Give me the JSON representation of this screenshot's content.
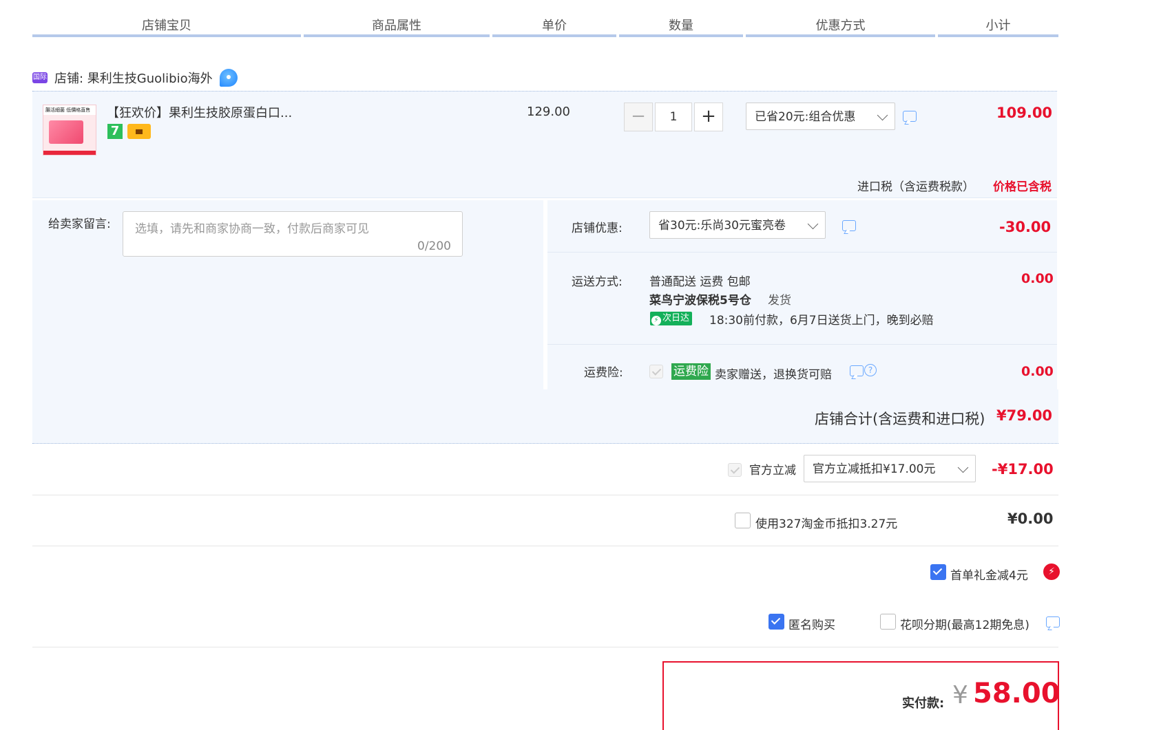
{
  "header": {
    "columns": [
      "店铺宝贝",
      "商品属性",
      "单价",
      "数量",
      "优惠方式",
      "小计"
    ]
  },
  "shop": {
    "badge": "国际",
    "name": "店铺: 果利生技Guolibio海外"
  },
  "item": {
    "thumb_text": "腸活細菌 低價格直售",
    "title": "【狂欢价】果利生技胶原蛋白口...",
    "badge_7": "7",
    "unit_price": "129.00",
    "quantity": "1",
    "discount_option": "已省20元:组合优惠",
    "subtotal": "109.00",
    "tax_label": "进口税（含运费税款）",
    "tax_value": "价格已含税"
  },
  "message": {
    "label": "给卖家留言:",
    "placeholder": "选填，请先和商家协商一致，付款后商家可见",
    "counter": "0/200"
  },
  "shop_coupon": {
    "label": "店铺优惠:",
    "option": "省30元:乐尚30元蜜亮卷",
    "amount": "-30.00"
  },
  "shipping": {
    "label": "运送方式:",
    "line1": "普通配送 运费 包邮",
    "warehouse": "菜鸟宁波保税5号仓",
    "dispatch": "发货",
    "badge": "次日达",
    "note": "18:30前付款，6月7日送货上门，晚到必赔",
    "amount": "0.00"
  },
  "insurance": {
    "label": "运费险:",
    "badge": "运费险",
    "text": "卖家赠送，退换货可赔",
    "amount": "0.00"
  },
  "shop_total": {
    "label": "店铺合计(含运费和进口税)",
    "amount": "¥79.00"
  },
  "official_discount": {
    "label": "官方立减",
    "option": "官方立减抵扣¥17.00元",
    "amount": "-¥17.00"
  },
  "coins": {
    "label": "使用327淘金币抵扣3.27元",
    "amount": "¥0.00"
  },
  "first_order": {
    "label": "首单礼金减4元"
  },
  "anonymous": {
    "label": "匿名购买"
  },
  "huabei": {
    "label": "花呗分期(最高12期免息)"
  },
  "payment": {
    "label": "实付款:",
    "currency": "¥",
    "amount": "58.00"
  },
  "colors": {
    "accent_red": "#e8112d",
    "link_blue": "#6aa8ff",
    "panel_bg": "#f3f7fd",
    "checkbox_blue": "#3a74f1"
  }
}
